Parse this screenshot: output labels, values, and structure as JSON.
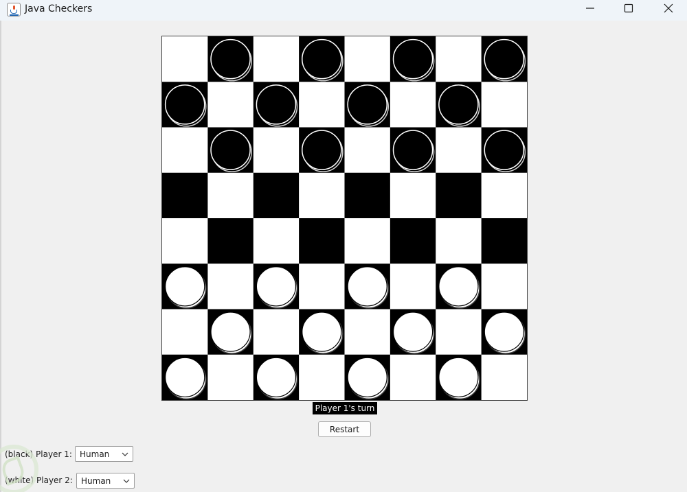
{
  "window": {
    "title": "Java Checkers",
    "icon": "java-cup-icon",
    "controls": [
      "minimize-icon",
      "maximize-icon",
      "close-icon"
    ]
  },
  "board": {
    "size": 8,
    "colors": {
      "dark": "#000000",
      "light": "#ffffff"
    },
    "rows": [
      "-b-b-b-b",
      "b-b-b-b-",
      "-b-b-b-b",
      "--------",
      "--------",
      "w-w-w-w-",
      "-w-w-w-w",
      "w-w-w-w-"
    ]
  },
  "status": {
    "text": "Player 1's turn"
  },
  "controls": {
    "restart_label": "Restart",
    "player1": {
      "label": "(black) Player 1:",
      "value": "Human"
    },
    "player2": {
      "label": "(white) Player 2:",
      "value": "Human"
    }
  }
}
